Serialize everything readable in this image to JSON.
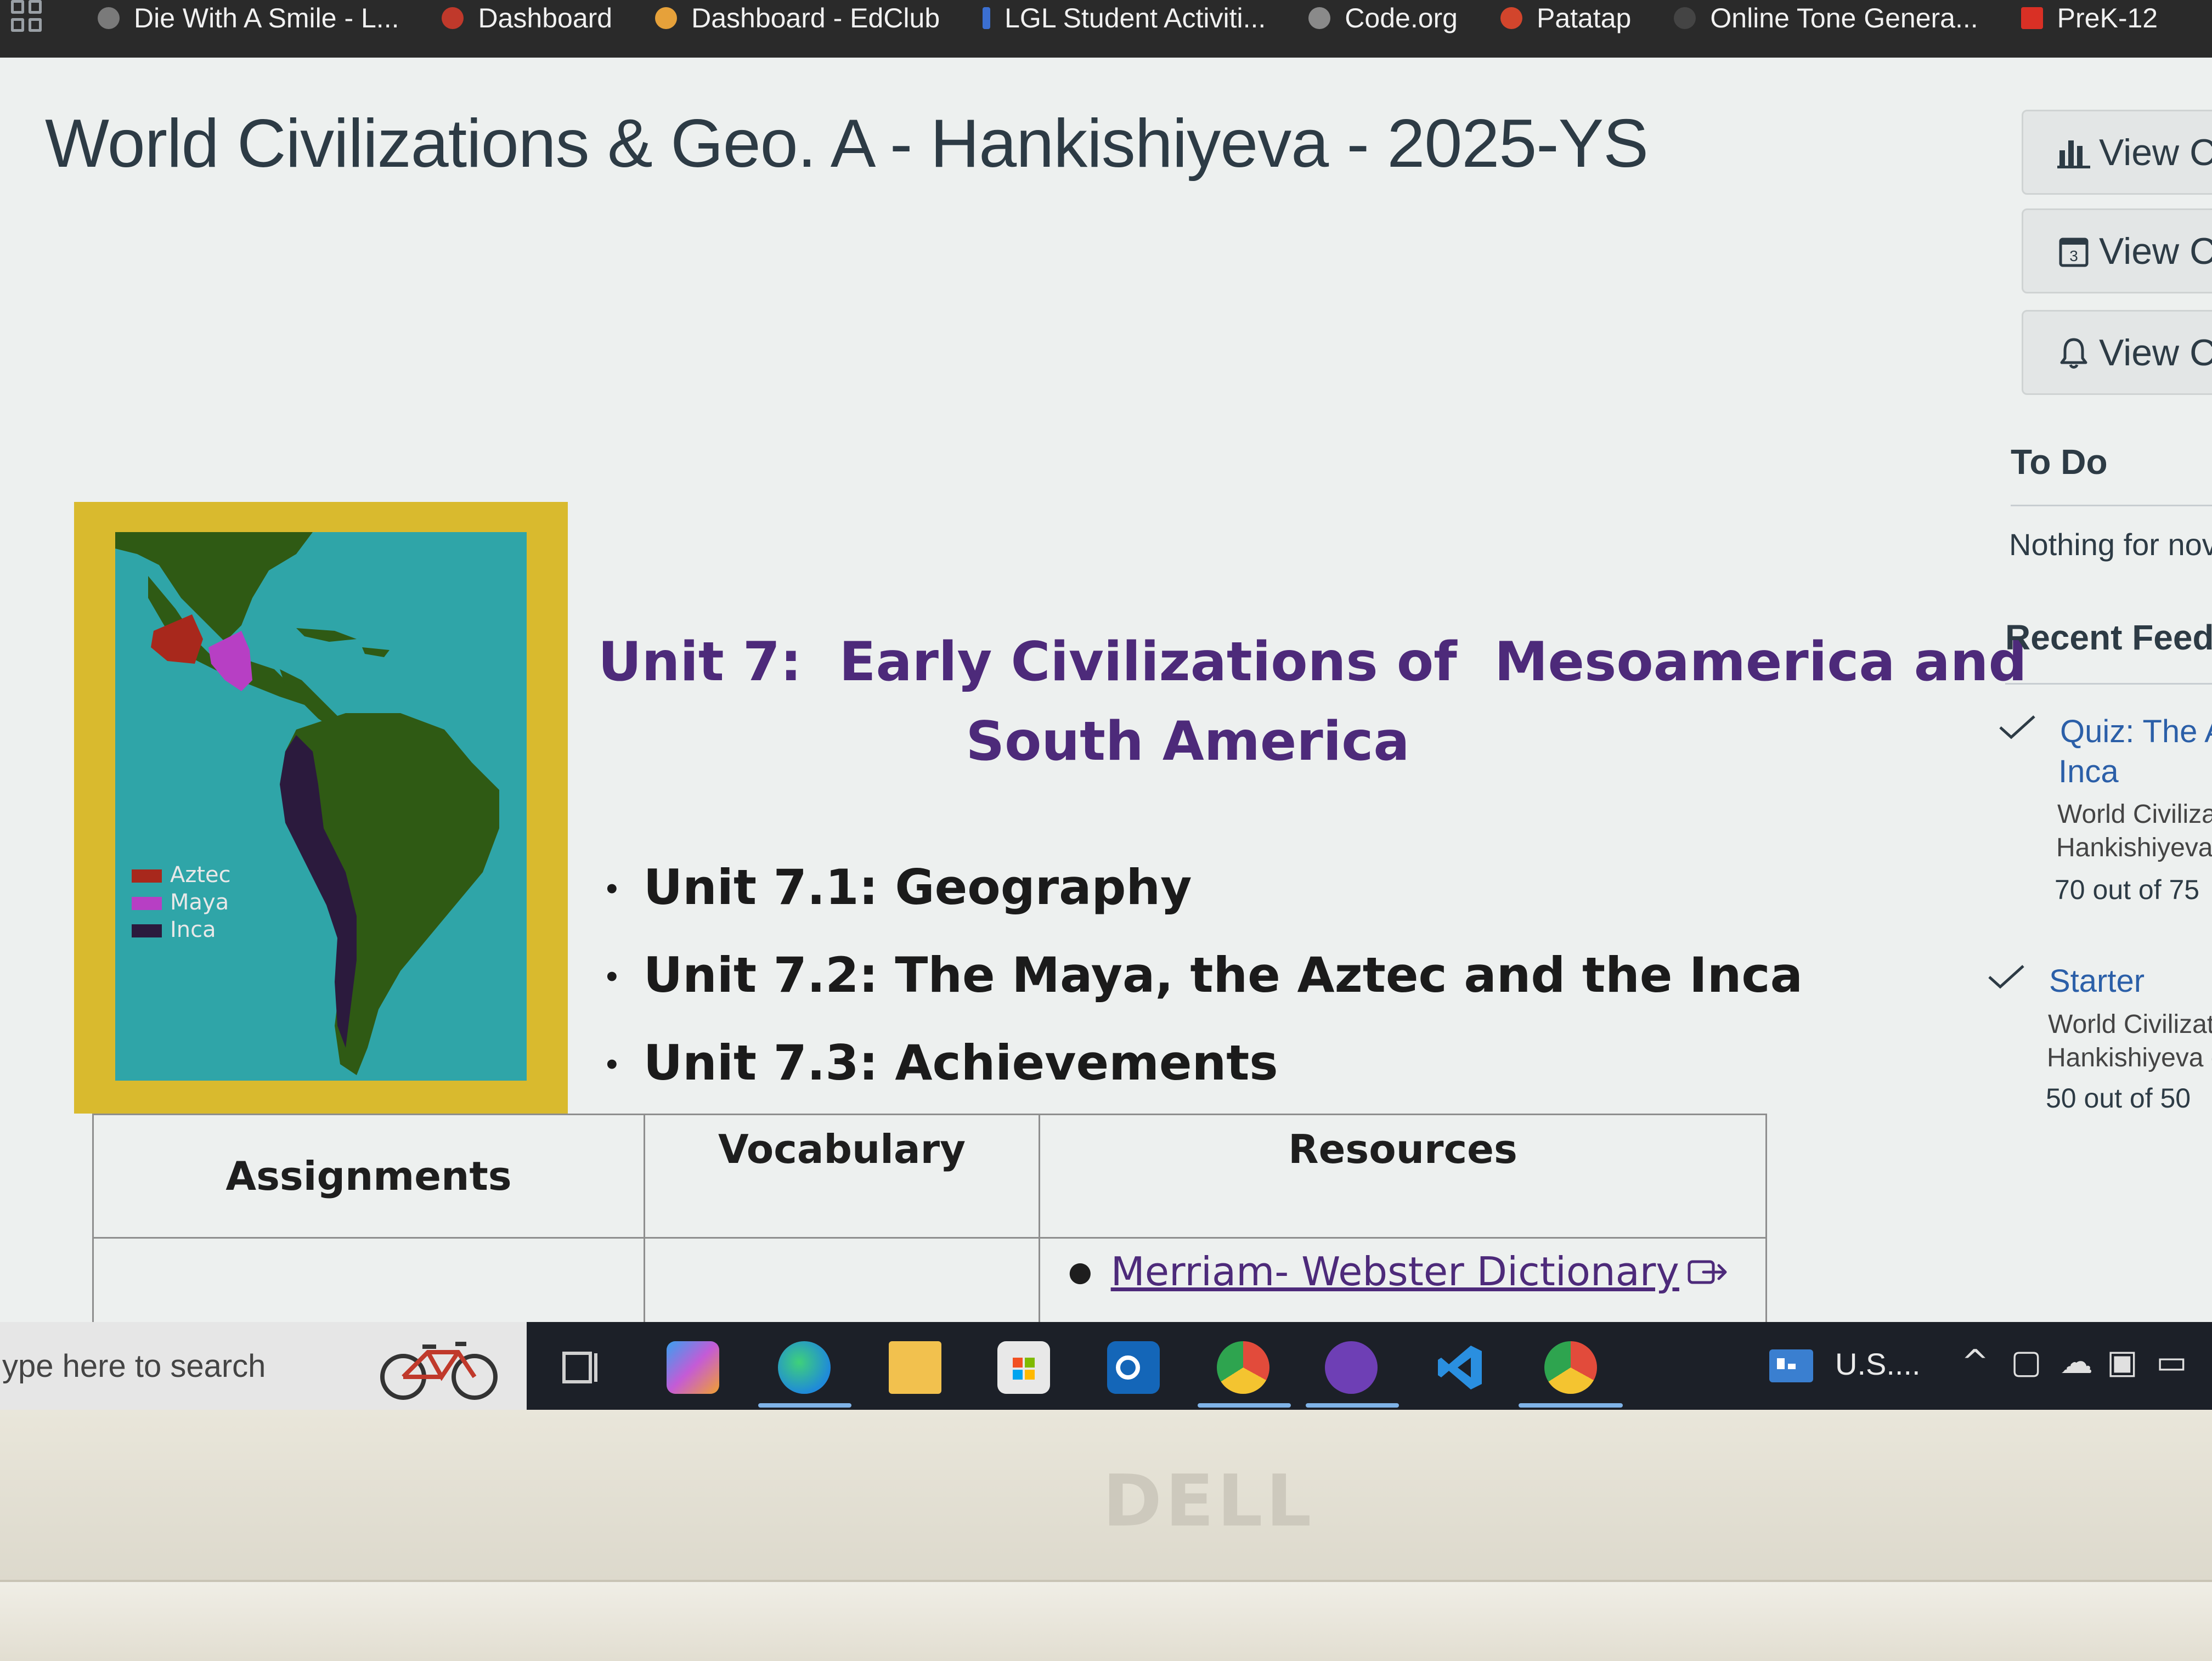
{
  "bookmarks": [
    {
      "label": "Die With A Smile - L...",
      "color": "#7a7a7a"
    },
    {
      "label": "Dashboard",
      "color": "#c0392b"
    },
    {
      "label": "Dashboard - EdClub",
      "color": "#e6a13a"
    },
    {
      "label": "LGL Student Activiti...",
      "color": "#3b6fd1"
    },
    {
      "label": "Code.org",
      "color": "#8a8a8a"
    },
    {
      "label": "Patatap",
      "color": "#d2452c"
    },
    {
      "label": "Online Tone Genera...",
      "color": "#444444"
    },
    {
      "label": "PreK-12",
      "color": "#d93025"
    }
  ],
  "course": {
    "title": "World Civilizations & Geo. A - Hankishiyeva - 2025-YS"
  },
  "map": {
    "legend": [
      {
        "label": "Aztec",
        "color": "#a8281c"
      },
      {
        "label": "Maya",
        "color": "#b73fc4"
      },
      {
        "label": "Inca",
        "color": "#2b1a3d"
      }
    ],
    "colors": {
      "frame": "#d9ba2e",
      "ocean": "#2fa5a8",
      "land": "#2f5a14"
    }
  },
  "unit": {
    "heading_line1": "Unit 7:  Early Civilizations of  Mesoamerica and",
    "heading_line2": "South America",
    "items": [
      "Unit 7.1: Geography",
      "Unit 7.2: The Maya, the Aztec and the Inca",
      "Unit 7.3: Achievements"
    ]
  },
  "table": {
    "headers": [
      "Assignments",
      "Vocabulary",
      "Resources"
    ],
    "resources": [
      "Merriam- Webster Dictionary"
    ]
  },
  "sidebar": {
    "buttons": [
      {
        "label": "View Co",
        "icon": "bar-chart-icon"
      },
      {
        "label": "View Co",
        "icon": "calendar-icon"
      },
      {
        "label": "View Co",
        "icon": "bell-icon"
      }
    ],
    "calendar_day": "3",
    "todo_heading": "To Do",
    "todo_empty": "Nothing for nov",
    "feedback_heading": "Recent Feedb",
    "feedback": [
      {
        "title_line1": "Quiz: The A",
        "title_line2": "Inca",
        "course_line1": "World Civiliza",
        "course_line2": "Hankishiyeva",
        "score": "70 out of 75"
      },
      {
        "title_line1": "Starter",
        "course_line1": "World Civilizat",
        "course_line2": "Hankishiyeva -",
        "score": "50 out of 50"
      }
    ]
  },
  "taskbar": {
    "search_placeholder": "ype here to search",
    "apps": [
      {
        "name": "task-view-icon",
        "color": "#1c2028"
      },
      {
        "name": "copilot-icon",
        "color": "#c45bd6"
      },
      {
        "name": "edge-icon",
        "color": "#1f8ad9"
      },
      {
        "name": "file-explorer-icon",
        "color": "#f2c14e"
      },
      {
        "name": "microsoft-store-icon",
        "color": "#e8e8e8"
      },
      {
        "name": "outlook-icon",
        "color": "#1466b8"
      },
      {
        "name": "chrome-icon",
        "color": "#e24b3b"
      },
      {
        "name": "github-desktop-icon",
        "color": "#6e3fb5"
      },
      {
        "name": "vscode-icon",
        "color": "#2a8fe0"
      },
      {
        "name": "chrome-icon",
        "color": "#e24b3b"
      }
    ],
    "tray_text": "U.S...."
  },
  "bezel": {
    "logo": "DELL"
  }
}
